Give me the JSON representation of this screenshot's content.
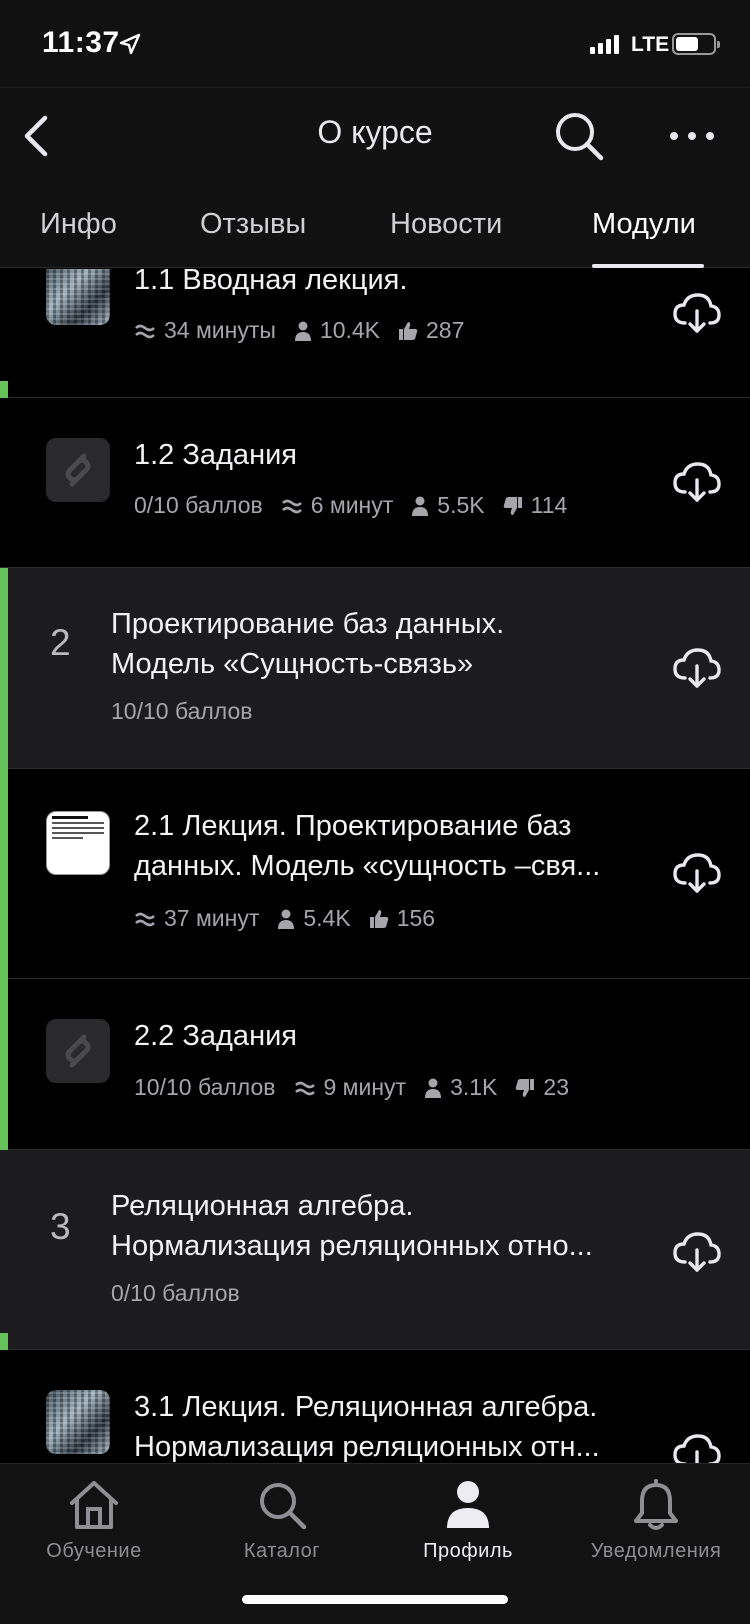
{
  "status_bar": {
    "time": "11:37",
    "network": "LTE"
  },
  "header": {
    "title": "О курсе"
  },
  "tabs": [
    {
      "label": "Инфо"
    },
    {
      "label": "Отзывы"
    },
    {
      "label": "Новости"
    },
    {
      "label": "Модули",
      "active": true
    }
  ],
  "lessons": {
    "l11": {
      "title": "1.1 Вводная лекция.",
      "duration": "34 минуты",
      "views": "10.4K",
      "likes": "287"
    },
    "l12": {
      "title": "1.2 Задания",
      "score": "0/10 баллов",
      "duration": "6 минут",
      "views": "5.5K",
      "dislikes": "114"
    },
    "l21": {
      "title_line1": "2.1 Лекция. Проектирование баз",
      "title_line2": "данных. Модель «сущность –свя...",
      "duration": "37 минут",
      "views": "5.4K",
      "likes": "156"
    },
    "l22": {
      "title": "2.2 Задания",
      "score": "10/10 баллов",
      "duration": "9 минут",
      "views": "3.1K",
      "dislikes": "23"
    },
    "l31": {
      "title_line1": "3.1 Лекция. Реляционная алгебра.",
      "title_line2": "Нормализация реляционных отн..."
    }
  },
  "modules": {
    "m2": {
      "number": "2",
      "title_line1": "Проектирование баз данных.",
      "title_line2": "Модель «Сущность-связь»",
      "score": "10/10 баллов"
    },
    "m3": {
      "number": "3",
      "title_line1": "Реляционная алгебра.",
      "title_line2": "Нормализация реляционных отно...",
      "score": "0/10 баллов"
    }
  },
  "tabbar": [
    {
      "label": "Обучение",
      "icon": "home-icon"
    },
    {
      "label": "Каталог",
      "icon": "search-icon"
    },
    {
      "label": "Профиль",
      "icon": "profile-icon",
      "active": true
    },
    {
      "label": "Уведомления",
      "icon": "bell-icon"
    }
  ],
  "colors": {
    "accent_green": "#66c25a",
    "module_bg": "#1c1c1e",
    "background": "#000000"
  }
}
